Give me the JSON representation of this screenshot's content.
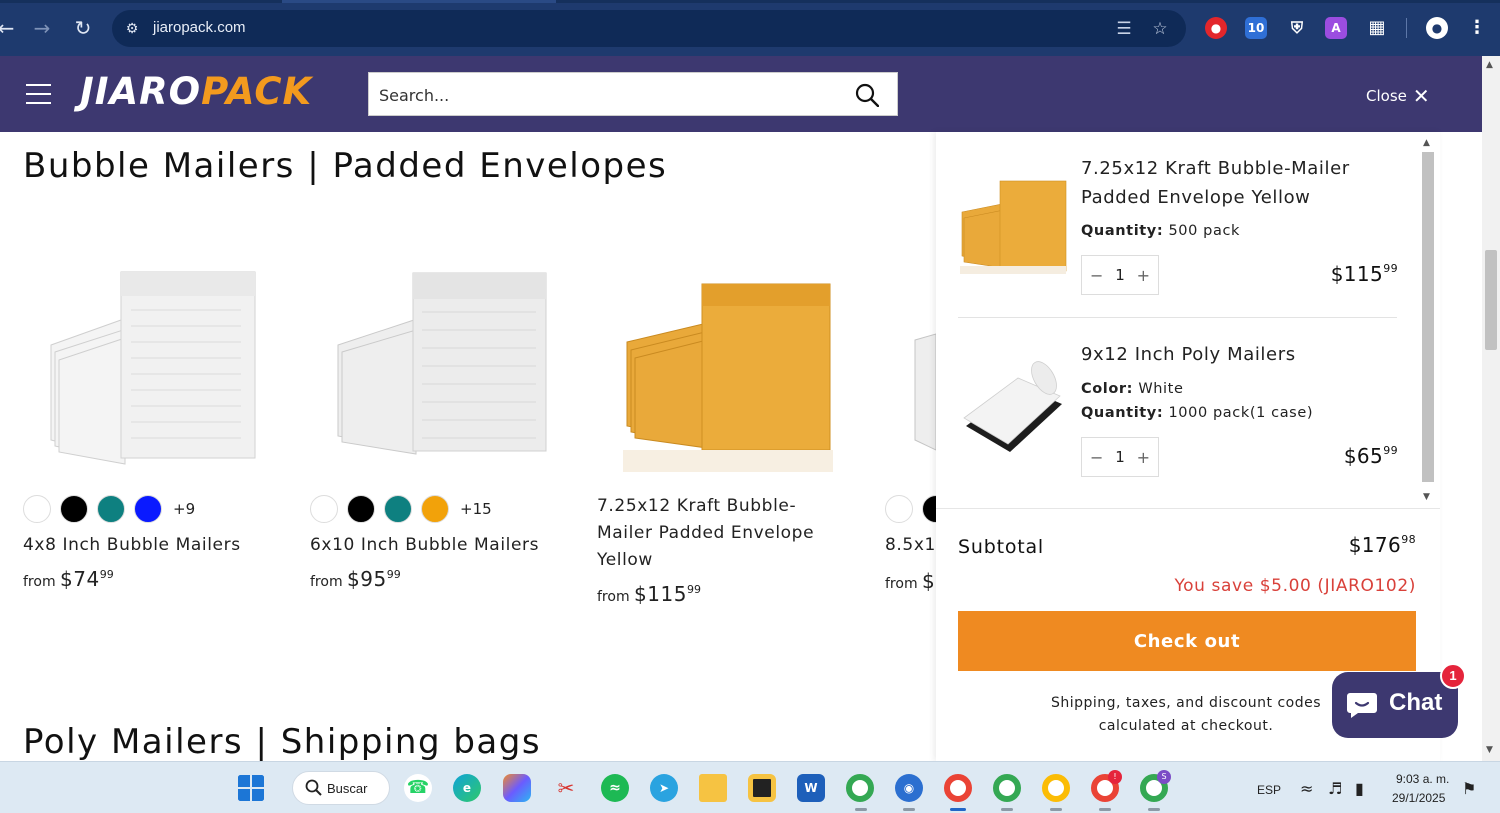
{
  "browser": {
    "url": "jiaropack.com",
    "back_icon": "arrow-left-icon",
    "forward_icon": "arrow-right-icon",
    "reload_icon": "reload-icon"
  },
  "header": {
    "logo_part1": "JIARO",
    "logo_part2": "PACK",
    "search_placeholder": "Search...",
    "close_label": "Close"
  },
  "main": {
    "section1_title": "Bubble Mailers | Padded Envelopes",
    "section2_title": "Poly Mailers | Shipping bags",
    "products": [
      {
        "title": "4x8 Inch Bubble Mailers",
        "price_prefix": "from",
        "price_whole": "$74",
        "price_cents": "99",
        "more_swatches": "+9",
        "swatches": [
          "#ffffff",
          "#000000",
          "#0e8080",
          "#0a1aff"
        ]
      },
      {
        "title": "6x10 Inch Bubble Mailers",
        "price_prefix": "from",
        "price_whole": "$95",
        "price_cents": "99",
        "more_swatches": "+15",
        "swatches": [
          "#ffffff",
          "#000000",
          "#0e8080",
          "#f2a20a"
        ]
      },
      {
        "title": "7.25x12 Kraft Bubble-Mailer Padded Envelope Yellow",
        "price_prefix": "from",
        "price_whole": "$115",
        "price_cents": "99"
      },
      {
        "title": "8.5x1",
        "price_prefix": "from",
        "price_whole": "$",
        "price_cents": ""
      }
    ]
  },
  "cart": {
    "items": [
      {
        "name": "7.25x12 Kraft Bubble-Mailer Padded Envelope Yellow",
        "opt1_label": "Quantity:",
        "opt1_value": "500 pack",
        "qty": "1",
        "price_whole": "$115",
        "price_cents": "99"
      },
      {
        "name": "9x12 Inch Poly Mailers",
        "opt1_label": "Color:",
        "opt1_value": "White",
        "opt2_label": "Quantity:",
        "opt2_value": "1000 pack(1 case)",
        "qty": "1",
        "price_whole": "$65",
        "price_cents": "99"
      }
    ],
    "subtotal_label": "Subtotal",
    "subtotal_whole": "$176",
    "subtotal_cents": "98",
    "save_text": "You save $5.00 (JIARO102)",
    "checkout_label": "Check out",
    "shipping_note": "Shipping, taxes, and discount codes calculated at checkout."
  },
  "chat": {
    "label": "Chat",
    "badge": "1"
  },
  "taskbar": {
    "search_label": "Buscar",
    "lang": "ESP",
    "time": "9:03 a. m.",
    "date": "29/1/2025"
  },
  "colors": {
    "header_bg": "#3d3870",
    "accent_orange": "#ef8a21",
    "save_red": "#d9413a"
  }
}
